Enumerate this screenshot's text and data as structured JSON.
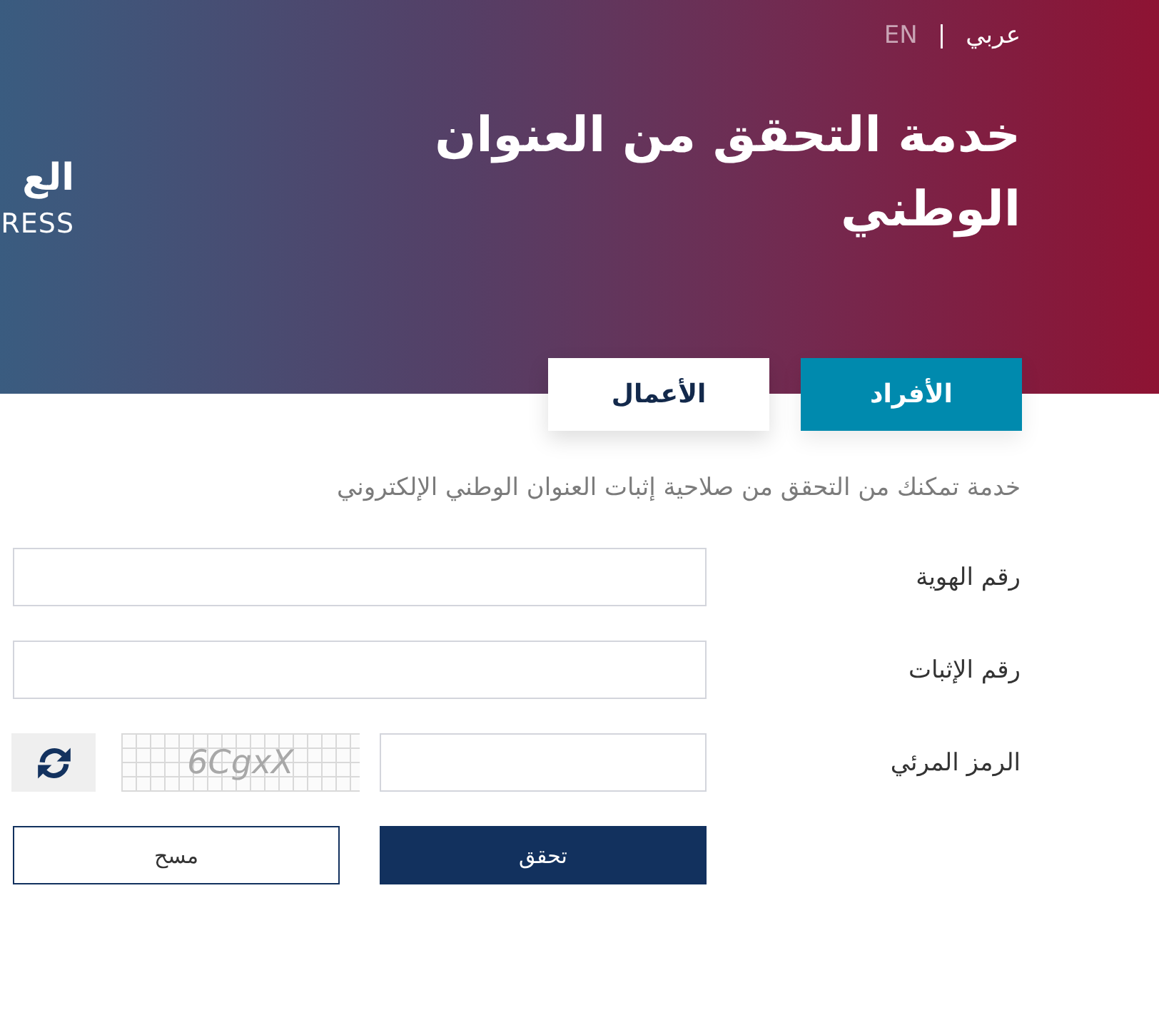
{
  "header": {
    "logo": {
      "arabic": "الع",
      "latin": "RESS"
    },
    "language_switch": {
      "items": [
        {
          "label": "عربي",
          "selected": true
        },
        {
          "label": "EN",
          "selected": false
        }
      ],
      "separator": "|"
    },
    "title": "خدمة التحقق من العنوان الوطني"
  },
  "tabs": [
    {
      "label": "الأفراد",
      "selected": true
    },
    {
      "label": "الأعمال",
      "selected": false
    }
  ],
  "description": "خدمة تمكنك من التحقق من صلاحية إثبات العنوان الوطني الإلكتروني",
  "form": {
    "fields": [
      {
        "kind": "text",
        "label": "رقم الهوية"
      },
      {
        "kind": "text",
        "label": "رقم الإثبات"
      },
      {
        "kind": "captcha",
        "label": "الرمز المرئي",
        "captcha_code": "6CgxX"
      }
    ],
    "buttons": [
      {
        "kind": "primary",
        "label": "تحقق"
      },
      {
        "kind": "secondary",
        "label": "مسح"
      }
    ]
  }
}
